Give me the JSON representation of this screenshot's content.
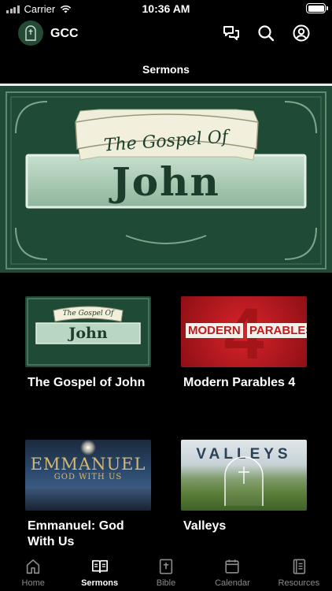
{
  "status_bar": {
    "carrier": "Carrier",
    "time": "10:36 AM"
  },
  "header": {
    "app_name": "GCC"
  },
  "page": {
    "title": "Sermons"
  },
  "hero": {
    "line1": "The Gospel Of",
    "line2": "John"
  },
  "sermons": [
    {
      "title": "The Gospel of John",
      "art_line1": "The Gospel Of",
      "art_line2": "John"
    },
    {
      "title": "Modern Parables 4",
      "art_line1": "MODERN",
      "art_line2": "PARABLES",
      "art_number": "4"
    },
    {
      "title": "Emmanuel: God With Us",
      "art_line1": "EMMANUEL",
      "art_line2": "GOD WITH US"
    },
    {
      "title": "Valleys",
      "art_line1": "VALLEYS"
    }
  ],
  "tabs": [
    {
      "label": "Home",
      "icon": "home-icon"
    },
    {
      "label": "Sermons",
      "icon": "book-open-icon",
      "active": true
    },
    {
      "label": "Bible",
      "icon": "bible-icon"
    },
    {
      "label": "Calendar",
      "icon": "calendar-icon"
    },
    {
      "label": "Resources",
      "icon": "resources-icon"
    }
  ],
  "colors": {
    "background": "#000000",
    "brand_green": "#1f4a35",
    "inactive_tab": "#8a8a8a"
  }
}
